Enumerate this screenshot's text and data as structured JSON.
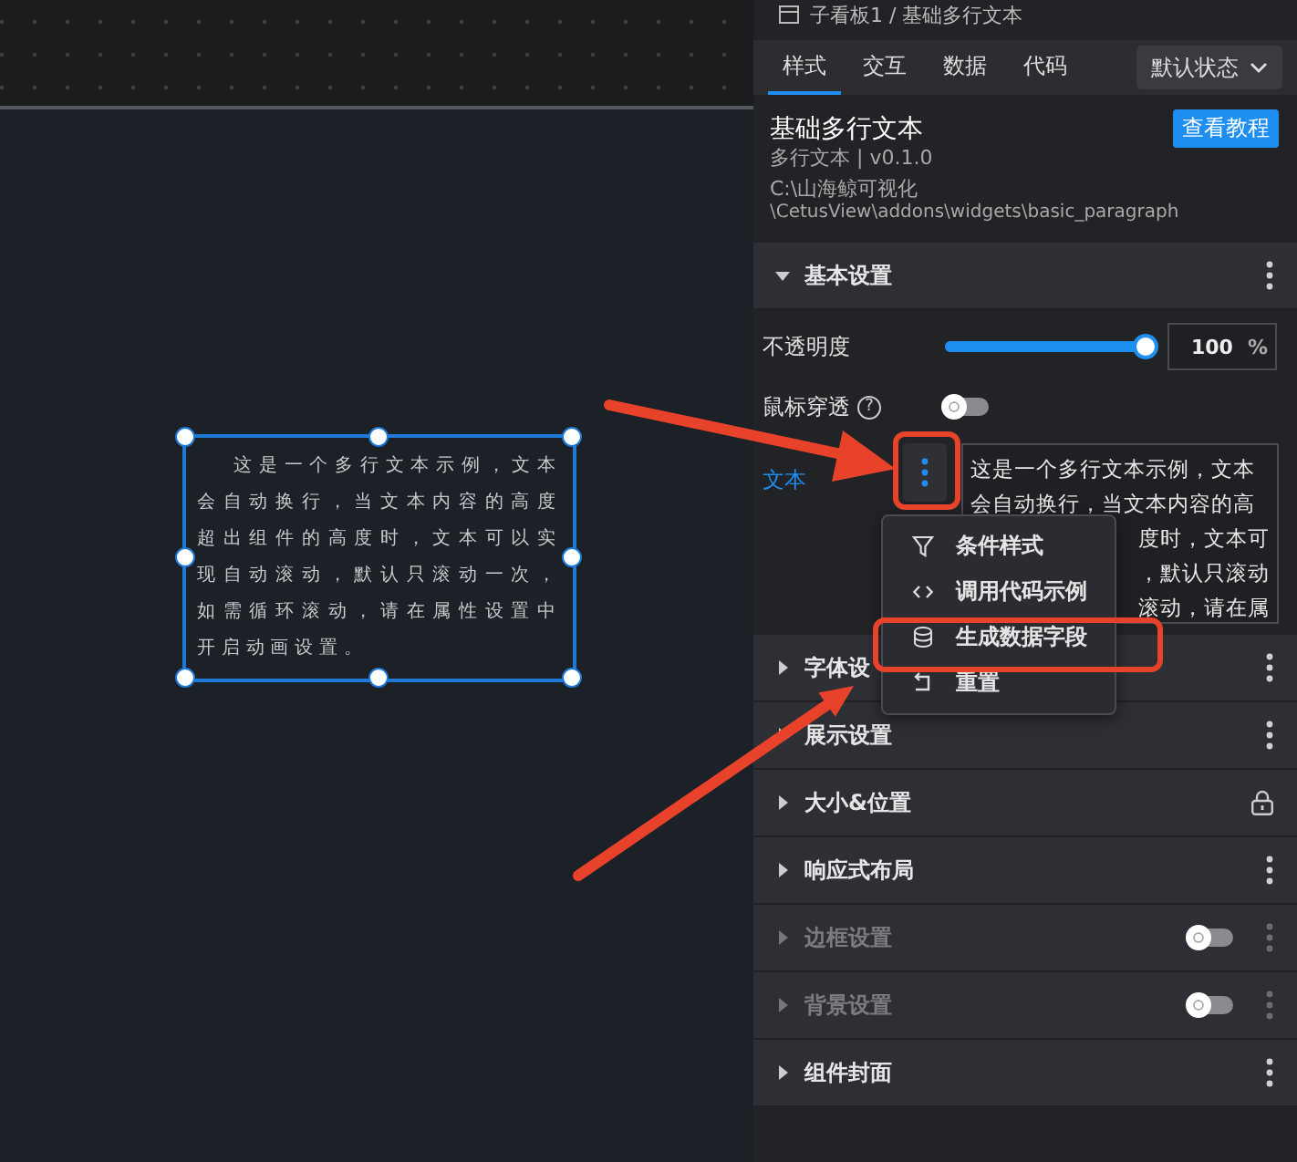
{
  "breadcrumb": "子看板1 / 基础多行文本",
  "canvas": {
    "paragraph": "这是一个多行文本示例，文本会自动换行，当文本内容的高度超出组件的高度时，文本可以实现自动滚动，默认只滚动一次，如需循环滚动，请在属性设置中开启动画设置。"
  },
  "tabs": [
    {
      "label": "样式",
      "selected": true
    },
    {
      "label": "交互",
      "selected": false
    },
    {
      "label": "数据",
      "selected": false
    },
    {
      "label": "代码",
      "selected": false
    }
  ],
  "state_dropdown": {
    "value": "默认状态"
  },
  "component": {
    "name": "基础多行文本",
    "tutorial_button": "查看教程",
    "type_version": "多行文本 | v0.1.0",
    "path": [
      "C:\\山海鲸可视化",
      "\\CetusView\\addons\\widgets\\basic_paragraph"
    ]
  },
  "basic_settings": {
    "title": "基本设置",
    "expanded": true,
    "opacity": {
      "label": "不透明度",
      "level": 1,
      "value": "100",
      "unit": "%"
    },
    "mouse_through": {
      "label": "鼠标穿透",
      "help": "?",
      "on": false
    },
    "text": {
      "label": "文本",
      "lines": [
        {
          "kind": "full",
          "text": "这是一个多行文本示例，文本"
        },
        {
          "kind": "full",
          "text": "会自动换行，当文本内容的高"
        },
        {
          "kind": "tail",
          "text": "度时，文本可"
        },
        {
          "kind": "tail",
          "text": "，默认只滚动"
        },
        {
          "kind": "tail",
          "text": "滚动，请在属"
        }
      ]
    }
  },
  "context_menu": {
    "items": [
      {
        "kind": "filter",
        "label": "条件样式"
      },
      {
        "kind": "code",
        "label": "调用代码示例"
      },
      {
        "kind": "database",
        "label": "生成数据字段"
      },
      {
        "kind": "reset",
        "label": "重置"
      }
    ]
  },
  "sections": [
    {
      "title": "字体设",
      "expanded": false,
      "disabled": false,
      "kind": "menu"
    },
    {
      "title": "展示设置",
      "expanded": false,
      "disabled": false,
      "kind": "menu"
    },
    {
      "title": "大小&位置",
      "expanded": false,
      "disabled": false,
      "kind": "lock"
    },
    {
      "title": "响应式布局",
      "expanded": false,
      "disabled": false,
      "kind": "menu"
    },
    {
      "title": "边框设置",
      "expanded": false,
      "disabled": true,
      "kind": "toggle",
      "on": false
    },
    {
      "title": "背景设置",
      "expanded": false,
      "disabled": true,
      "kind": "toggle",
      "on": false
    },
    {
      "title": "组件封面",
      "expanded": false,
      "disabled": false,
      "kind": "menu"
    }
  ]
}
